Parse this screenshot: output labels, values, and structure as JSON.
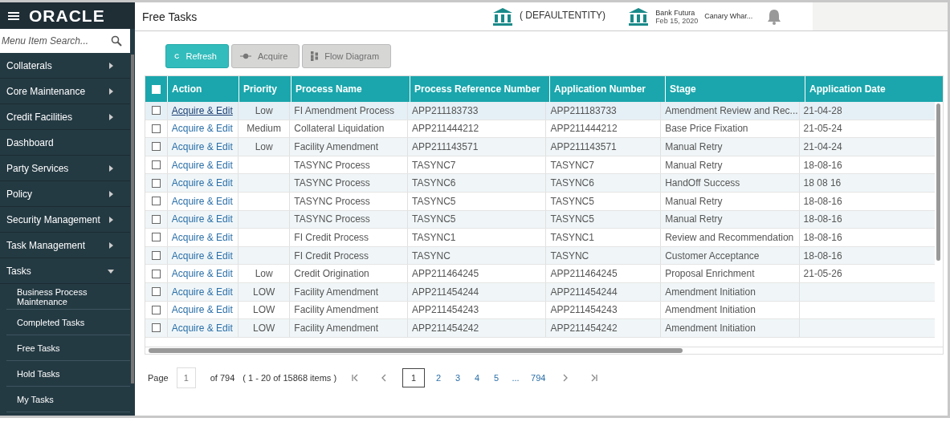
{
  "header": {
    "logo": "ORACLE",
    "title": "Free Tasks",
    "entity": "( DEFAULTENTITY)",
    "bank": "Bank Futura",
    "date": "Feb 15, 2020",
    "branch": "Canary Whar..."
  },
  "sidebar": {
    "search": {
      "placeholder": "Menu Item Search..."
    },
    "items": [
      {
        "label": "Collaterals",
        "expandable": true,
        "expanded": false
      },
      {
        "label": "Core Maintenance",
        "expandable": true,
        "expanded": false
      },
      {
        "label": "Credit Facilities",
        "expandable": true,
        "expanded": false
      },
      {
        "label": "Dashboard",
        "expandable": false
      },
      {
        "label": "Party Services",
        "expandable": true,
        "expanded": false
      },
      {
        "label": "Policy",
        "expandable": true,
        "expanded": false
      },
      {
        "label": "Security Management",
        "expandable": true,
        "expanded": false
      },
      {
        "label": "Task Management",
        "expandable": true,
        "expanded": false
      },
      {
        "label": "Tasks",
        "expandable": true,
        "expanded": true,
        "children": [
          {
            "label": "Business Process Maintenance"
          },
          {
            "label": "Completed Tasks"
          },
          {
            "label": "Free Tasks"
          },
          {
            "label": "Hold Tasks"
          },
          {
            "label": "My Tasks"
          }
        ]
      }
    ]
  },
  "toolbar": [
    {
      "label": "Refresh",
      "kind": "refresh",
      "disabled": false
    },
    {
      "label": "Acquire",
      "kind": "acquire",
      "disabled": true
    },
    {
      "label": "Flow Diagram",
      "kind": "flow",
      "disabled": true
    }
  ],
  "table": {
    "select_all": {
      "checked": false
    },
    "columns": [
      "Action",
      "Priority",
      "Process Name",
      "Process Reference Number",
      "Application Number",
      "Stage",
      "Application Date"
    ],
    "rows": [
      {
        "selected": true,
        "checked": false,
        "cells": [
          "Acquire & Edit",
          "Low",
          "FI Amendment Process",
          "APP211183733",
          "APP211183733",
          "Amendment Review and Rec...",
          "21-04-28"
        ]
      },
      {
        "selected": false,
        "checked": false,
        "cells": [
          "Acquire & Edit",
          "Medium",
          "Collateral Liquidation",
          "APP211444212",
          "APP211444212",
          "Base Price Fixation",
          "21-05-24"
        ]
      },
      {
        "selected": false,
        "checked": false,
        "cells": [
          "Acquire & Edit",
          "Low",
          "Facility Amendment",
          "APP211143571",
          "APP211143571",
          "Manual Retry",
          "21-04-24"
        ]
      },
      {
        "selected": false,
        "checked": false,
        "cells": [
          "Acquire & Edit",
          "",
          "TASYNC Process",
          "TASYNC7",
          "TASYNC7",
          "Manual Retry",
          "18-08-16"
        ]
      },
      {
        "selected": false,
        "checked": false,
        "cells": [
          "Acquire & Edit",
          "",
          "TASYNC Process",
          "TASYNC6",
          "TASYNC6",
          "HandOff Success",
          "18 08 16"
        ]
      },
      {
        "selected": false,
        "checked": false,
        "cells": [
          "Acquire & Edit",
          "",
          "TASYNC Process",
          "TASYNC5",
          "TASYNC5",
          "Manual Retry",
          "18-08-16"
        ]
      },
      {
        "selected": false,
        "checked": false,
        "cells": [
          "Acquire & Edit",
          "",
          "TASYNC Process",
          "TASYNC5",
          "TASYNC5",
          "Manual Retry",
          "18-08-16"
        ]
      },
      {
        "selected": false,
        "checked": false,
        "cells": [
          "Acquire & Edit",
          "",
          "FI Credit Process",
          "TASYNC1",
          "TASYNC1",
          "Review and Recommendation",
          "18-08-16"
        ]
      },
      {
        "selected": false,
        "checked": false,
        "cells": [
          "Acquire & Edit",
          "",
          "FI Credit Process",
          "TASYNC",
          "TASYNC",
          "Customer Acceptance",
          "18-08-16"
        ]
      },
      {
        "selected": false,
        "checked": false,
        "cells": [
          "Acquire & Edit",
          "Low",
          "Credit Origination",
          "APP211464245",
          "APP211464245",
          "Proposal Enrichment",
          "21-05-26"
        ]
      },
      {
        "selected": false,
        "checked": false,
        "cells": [
          "Acquire & Edit",
          "LOW",
          "Facility Amendment",
          "APP211454244",
          "APP211454244",
          "Amendment Initiation",
          ""
        ]
      },
      {
        "selected": false,
        "checked": false,
        "cells": [
          "Acquire & Edit",
          "LOW",
          "Facility Amendment",
          "APP211454243",
          "APP211454243",
          "Amendment Initiation",
          ""
        ]
      },
      {
        "selected": false,
        "checked": false,
        "cells": [
          "Acquire & Edit",
          "LOW",
          "Facility Amendment",
          "APP211454242",
          "APP211454242",
          "Amendment Initiation",
          ""
        ]
      }
    ]
  },
  "pagination": {
    "label": "Page",
    "page_value": "1",
    "of": "of 794",
    "range": "( 1 - 20 of 15868 items )",
    "pages": [
      {
        "label": "1",
        "selected": true
      },
      {
        "label": "2",
        "selected": false
      },
      {
        "label": "3",
        "selected": false
      },
      {
        "label": "4",
        "selected": false
      },
      {
        "label": "5",
        "selected": false
      },
      {
        "label": "...",
        "selected": false
      },
      {
        "label": "794",
        "selected": false
      }
    ]
  }
}
